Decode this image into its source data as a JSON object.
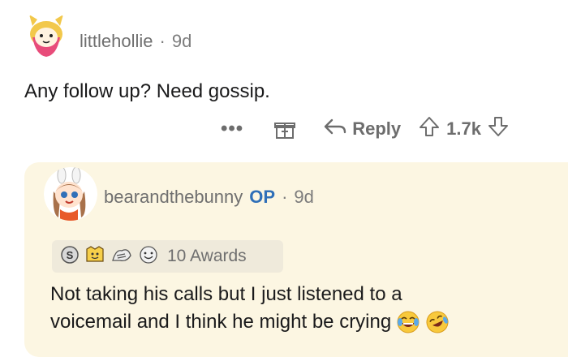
{
  "comment": {
    "username": "littlehollie",
    "separator": "·",
    "age": "9d",
    "text": "Any follow up? Need gossip.",
    "actions": {
      "more_label": "•••",
      "reply_label": "Reply",
      "vote_count": "1.7k"
    }
  },
  "reply": {
    "username": "bearandthebunny",
    "op_badge": "OP",
    "separator": "·",
    "age": "9d",
    "awards_label": "10 Awards",
    "text_line1": "Not taking his calls but I just listened to a",
    "text_line2": "voicemail and I think he might be crying"
  },
  "colors": {
    "reply_background": "#fcf6e2",
    "op_blue": "#2f6fb8",
    "meta_gray": "#7c7c7c"
  },
  "icons": [
    "gift-icon",
    "reply-arrow-icon",
    "upvote-icon",
    "downvote-icon",
    "laughing-tears-emoji",
    "rofl-emoji"
  ]
}
